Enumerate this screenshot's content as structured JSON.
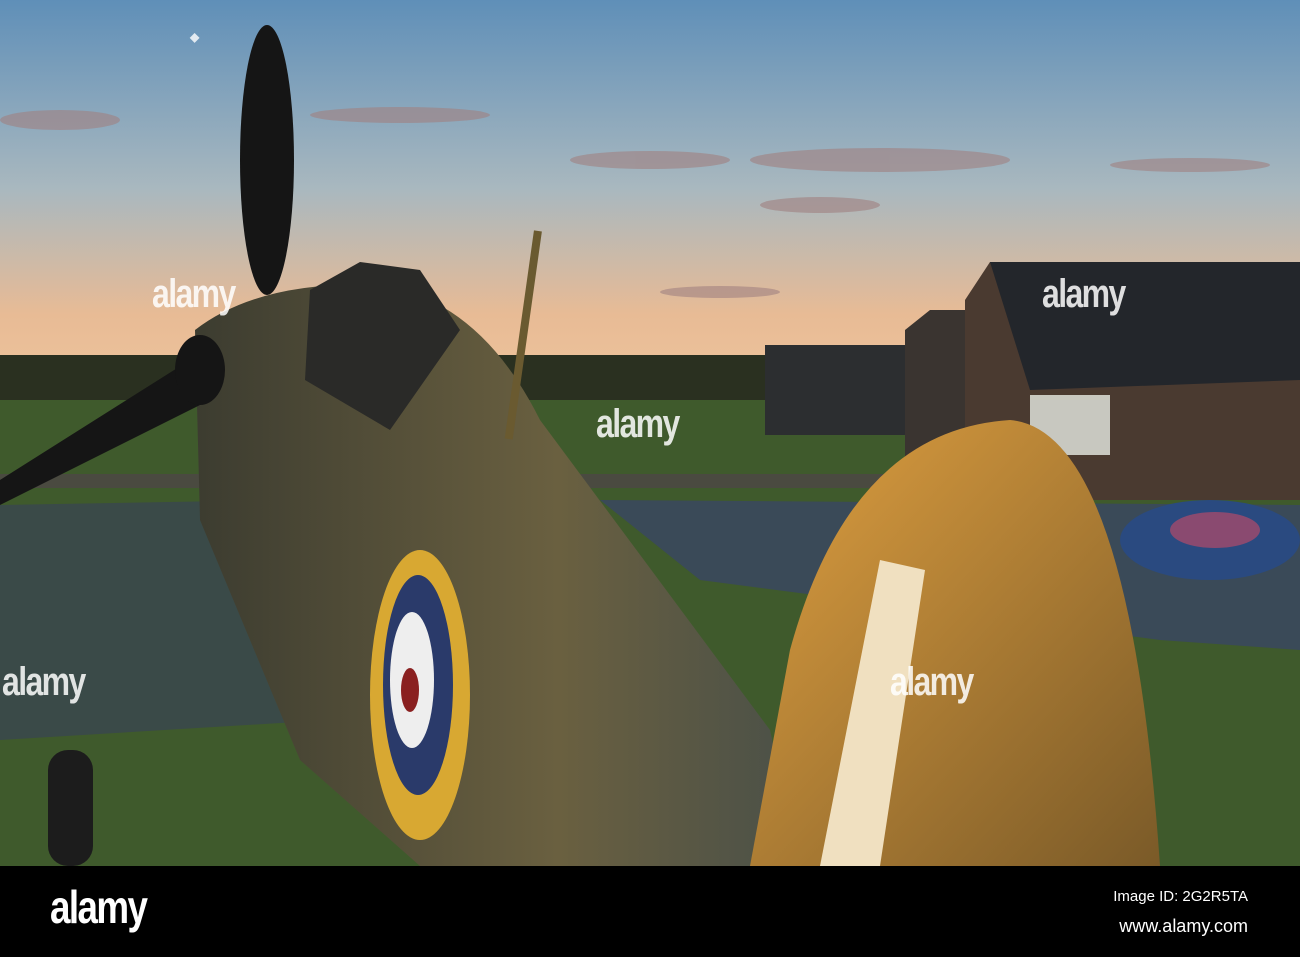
{
  "photo": {
    "subject": "hawker-hurricane-at-sunset"
  },
  "watermark": {
    "text": "alamy"
  },
  "footer": {
    "logo": "alamy",
    "image_id": "Image ID: 2G2R5TA",
    "url": "www.alamy.com"
  },
  "colors": {
    "sky_top": "#6e9bc0",
    "sky_horizon": "#e8b890",
    "grass": "#3d5a2a",
    "fuselage": "#4a4a35",
    "roundel_yellow": "#e0b030",
    "roundel_blue": "#2a3a6a",
    "roundel_red": "#8a2020",
    "bar": "#000000"
  }
}
